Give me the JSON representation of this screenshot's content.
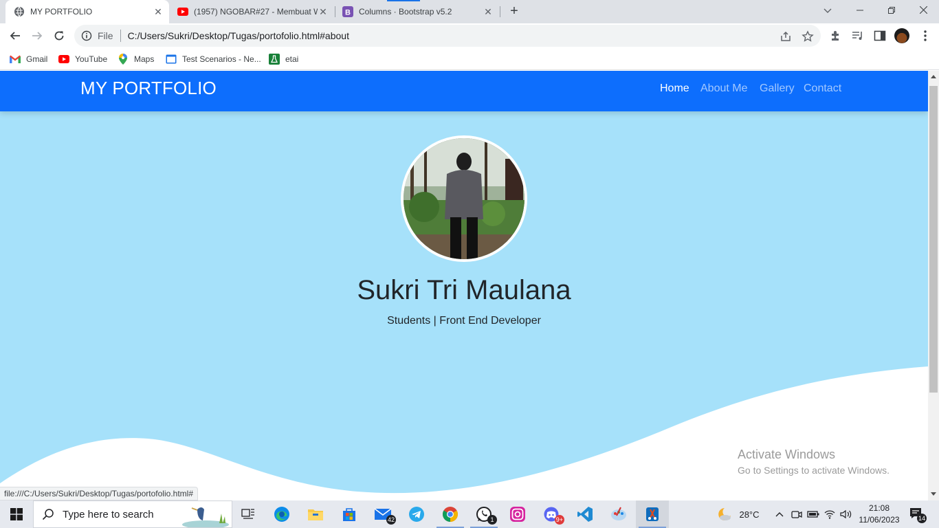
{
  "browser": {
    "tabs": [
      {
        "title": "MY PORTFOLIO",
        "icon": "globe-icon",
        "active": true
      },
      {
        "title": "(1957) NGOBAR#27 - Membuat W",
        "icon": "youtube-icon",
        "active": false
      },
      {
        "title": "Columns · Bootstrap v5.2",
        "icon": "bootstrap-icon",
        "active": false
      }
    ],
    "omnibox": {
      "scheme_label": "File",
      "url": "C:/Users/Sukri/Desktop/Tugas/portofolio.html#about"
    },
    "bookmarks": [
      {
        "label": "Gmail",
        "icon": "gmail-icon"
      },
      {
        "label": "YouTube",
        "icon": "youtube-icon"
      },
      {
        "label": "Maps",
        "icon": "maps-icon"
      },
      {
        "label": "Test Scenarios - Ne...",
        "icon": "folder-icon"
      },
      {
        "label": "etai",
        "icon": "flask-icon"
      }
    ],
    "status_url": "file:///C:/Users/Sukri/Desktop/Tugas/portofolio.html#"
  },
  "site": {
    "brand": "MY PORTFOLIO",
    "nav": [
      "Home",
      "About Me",
      "Gallery",
      "Contact"
    ],
    "hero": {
      "name": "Sukri Tri Maulana",
      "role": "Students | Front End Developer"
    },
    "colors": {
      "navbar": "#0d6efd",
      "hero_bg": "#a6e1fa",
      "wave": "#ffffff"
    }
  },
  "watermark": {
    "title": "Activate Windows",
    "subtitle": "Go to Settings to activate Windows."
  },
  "taskbar": {
    "search_placeholder": "Type here to search",
    "badges": {
      "mail": "42",
      "whatsapp": "1",
      "discord": "9+",
      "notifications": "14"
    },
    "weather": "28°C",
    "time": "21:08",
    "date": "11/06/2023"
  }
}
